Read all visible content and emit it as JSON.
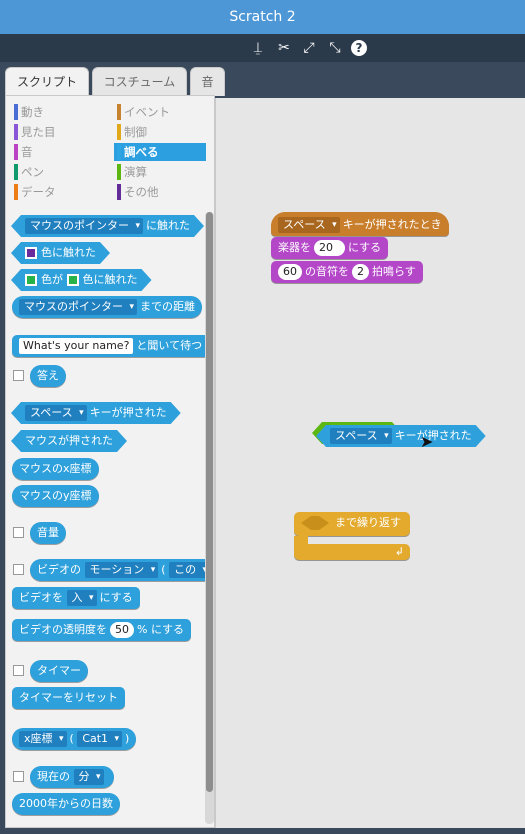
{
  "window": {
    "title": "Scratch 2"
  },
  "toolbar": {
    "tools": [
      {
        "name": "duplicate-stamp-icon",
        "glyph": "⍊"
      },
      {
        "name": "delete-scissors-icon",
        "glyph": "✂"
      },
      {
        "name": "grow-icon",
        "glyph": "⤢"
      },
      {
        "name": "shrink-icon",
        "glyph": "⤡"
      },
      {
        "name": "help-icon",
        "glyph": "?"
      }
    ]
  },
  "tabs": [
    {
      "label": "スクリプト"
    },
    {
      "label": "コスチューム"
    },
    {
      "label": "音"
    }
  ],
  "categories": [
    {
      "label": "動き",
      "color": "#4a6cd4"
    },
    {
      "label": "イベント",
      "color": "#c88330"
    },
    {
      "label": "見た目",
      "color": "#8a55d7"
    },
    {
      "label": "制御",
      "color": "#e1a91a"
    },
    {
      "label": "音",
      "color": "#bb42c3"
    },
    {
      "label": "調べる",
      "color": "#2ca5e2"
    },
    {
      "label": "ペン",
      "color": "#0e9a6c"
    },
    {
      "label": "演算",
      "color": "#5cb712"
    },
    {
      "label": "データ",
      "color": "#ee7d16"
    },
    {
      "label": "その他",
      "color": "#632d99"
    }
  ],
  "palette": {
    "touching_dd": "マウスのポインター",
    "touching_text": "に触れた",
    "touching_color_text": "色に触れた",
    "color_touching_a": "色が",
    "color_touching_b": "色に触れた",
    "distance_dd": "マウスのポインター",
    "distance_text": "までの距離",
    "ask_input": "What's your name?",
    "ask_text": "と聞いて待つ",
    "answer": "答え",
    "key_dd": "スペース",
    "key_text": "キーが押された",
    "mouse_down": "マウスが押された",
    "mouse_x": "マウスのx座標",
    "mouse_y": "マウスのy座標",
    "loudness": "音量",
    "video_prefix": "ビデオの",
    "video_dd": "モーション",
    "video_paren": "(",
    "video_dd2": "この",
    "video_set_a": "ビデオを",
    "video_set_dd": "入",
    "video_set_b": "にする",
    "video_trans_a": "ビデオの透明度を",
    "video_trans_val": "50",
    "video_trans_b": "% にする",
    "timer": "タイマー",
    "timer_reset": "タイマーをリセット",
    "of_dd": "x座標",
    "of_paren": "(",
    "of_dd2": "Cat1",
    "of_close": ")",
    "current_a": "現在の",
    "current_dd": "分",
    "days_since": "2000年からの日数"
  },
  "script": {
    "hat_dd": "スペース",
    "hat_text": "キーが押されたとき",
    "instrument_a": "楽器を",
    "instrument_val": "20",
    "instrument_b": "にする",
    "note_val": "60",
    "note_a": "の音符を",
    "note_beats": "2",
    "note_b": "拍鳴らす",
    "drag_dd": "スペース",
    "drag_text": "キーが押された",
    "repeat_text": "まで繰り返す",
    "loop_arrow": "↲"
  }
}
